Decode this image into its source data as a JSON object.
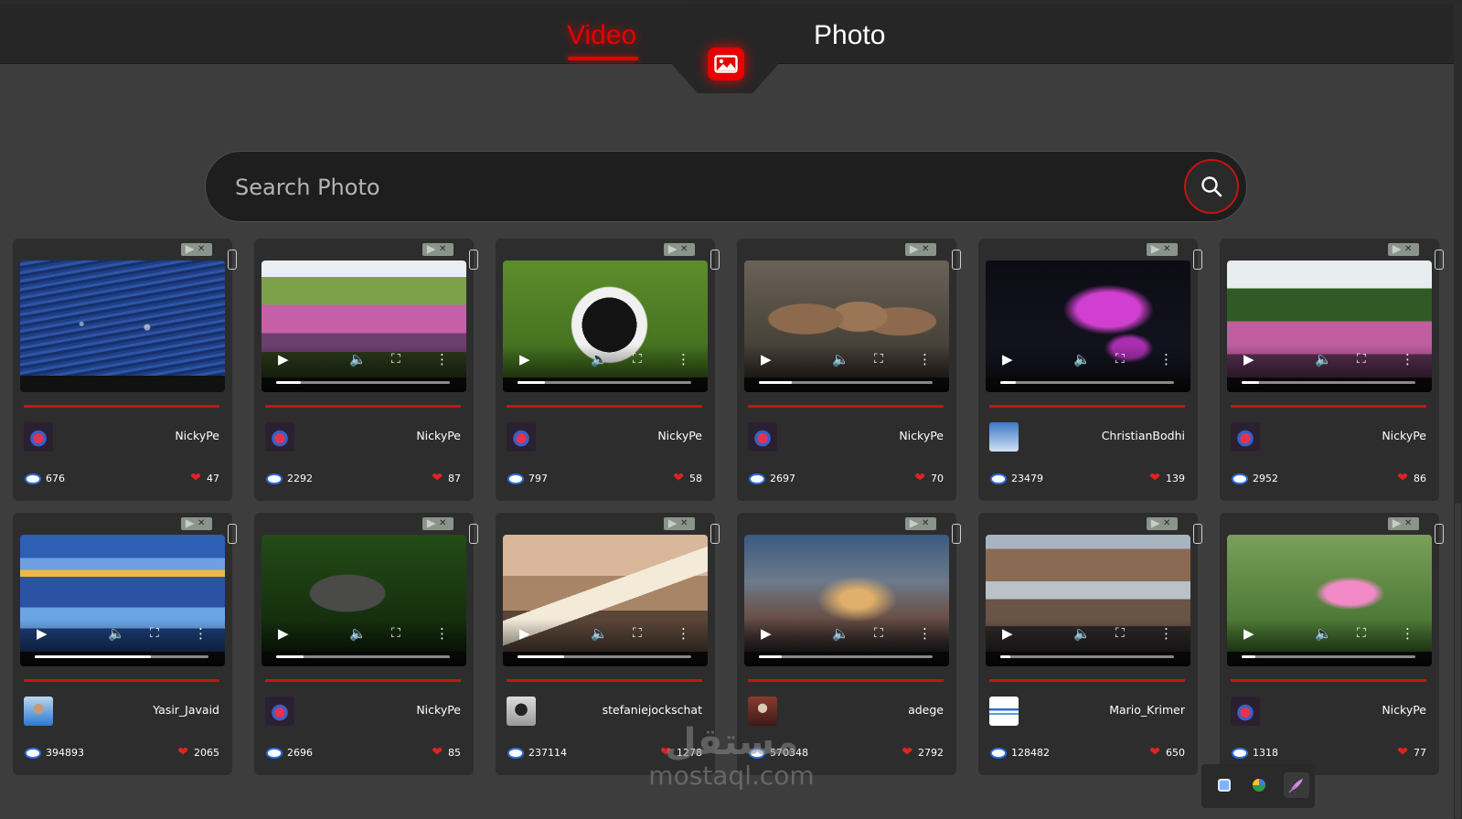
{
  "nav": {
    "tabs": [
      {
        "label": "Video",
        "active": true
      },
      {
        "label": "Photo",
        "active": false
      }
    ],
    "center_icon": "image-icon",
    "accent_color": "#e60000"
  },
  "search": {
    "placeholder": "Search Photo",
    "value": "",
    "button_icon": "search-icon"
  },
  "cards": [
    {
      "author": "NickyPe",
      "views": "676",
      "likes": "47",
      "kind": "photo",
      "scene": "water",
      "avatar": "heart"
    },
    {
      "author": "NickyPe",
      "views": "2292",
      "likes": "87",
      "kind": "video",
      "scene": "flowers",
      "avatar": "heart",
      "progress": 0.14,
      "muted": true
    },
    {
      "author": "NickyPe",
      "views": "797",
      "likes": "58",
      "kind": "video",
      "scene": "lemur",
      "avatar": "heart",
      "progress": 0.16,
      "muted": true
    },
    {
      "author": "NickyPe",
      "views": "2697",
      "likes": "70",
      "kind": "video",
      "scene": "monkeys",
      "avatar": "heart",
      "progress": 0.19,
      "muted": true
    },
    {
      "author": "ChristianBodhi",
      "views": "23479",
      "likes": "139",
      "kind": "video",
      "scene": "jellyfish",
      "avatar": "sky",
      "progress": 0.09,
      "muted": true
    },
    {
      "author": "NickyPe",
      "views": "2952",
      "likes": "86",
      "kind": "video",
      "scene": "field",
      "avatar": "heart",
      "progress": 0.1,
      "muted": true
    },
    {
      "author": "Yasir_Javaid",
      "views": "394893",
      "likes": "2065",
      "kind": "video",
      "scene": "coast",
      "avatar": "person",
      "progress": 0.67,
      "muted": true
    },
    {
      "author": "NickyPe",
      "views": "2696",
      "likes": "85",
      "kind": "video",
      "scene": "wolf",
      "avatar": "heart",
      "progress": 0.16,
      "muted": true
    },
    {
      "author": "stefaniejockschat",
      "views": "237114",
      "likes": "1278",
      "kind": "video",
      "scene": "book",
      "avatar": "bw",
      "progress": 0.27,
      "muted": false
    },
    {
      "author": "adege",
      "views": "570348",
      "likes": "2792",
      "kind": "video",
      "scene": "sunset",
      "avatar": "fig",
      "progress": 0.13,
      "muted": true
    },
    {
      "author": "Mario_Krimer",
      "views": "128482",
      "likes": "650",
      "kind": "video",
      "scene": "beach",
      "avatar": "wave",
      "progress": 0.06,
      "muted": true
    },
    {
      "author": "NickyPe",
      "views": "1318",
      "likes": "77",
      "kind": "video",
      "scene": "poppy",
      "avatar": "heart",
      "progress": 0.08,
      "muted": true
    }
  ],
  "watermark": {
    "arabic": "مستقل",
    "latin": "mostaql.com"
  },
  "floating_bar": {
    "icons": [
      "square-icon",
      "globe-icon",
      "feather-icon"
    ]
  }
}
